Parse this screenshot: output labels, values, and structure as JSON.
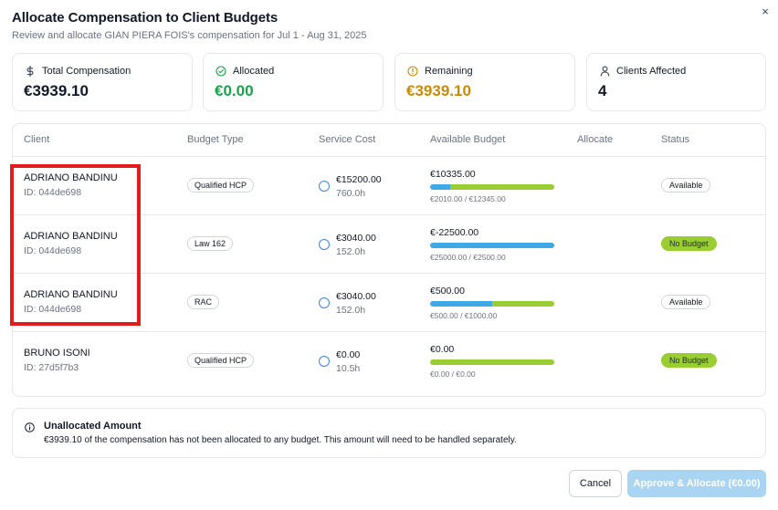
{
  "dialog": {
    "title": "Allocate Compensation to Client Budgets",
    "subtitle": "Review and allocate GIAN PIERA FOIS's compensation for Jul 1 - Aug 31, 2025",
    "close_glyph": "×"
  },
  "summary": {
    "total": {
      "label": "Total Compensation",
      "value": "€3939.10",
      "icon": "dollar-icon",
      "color": "#111827"
    },
    "allocated": {
      "label": "Allocated",
      "value": "€0.00",
      "icon": "check-circle-icon",
      "color": "#16a34a"
    },
    "remaining": {
      "label": "Remaining",
      "value": "€3939.10",
      "icon": "alert-circle-icon",
      "color": "#ca8a04"
    },
    "clients": {
      "label": "Clients Affected",
      "value": "4",
      "icon": "user-icon",
      "color": "#111827"
    }
  },
  "table": {
    "headers": {
      "client": "Client",
      "budget_type": "Budget Type",
      "service_cost": "Service Cost",
      "available_budget": "Available Budget",
      "allocate": "Allocate",
      "status": "Status"
    },
    "rows": [
      {
        "name": "ADRIANO BANDINU",
        "id": "ID: 044de698",
        "budget_type": "Qualified HCP",
        "cost": "€15200.00",
        "hours": "760.0h",
        "available": "€10335.00",
        "ratio": "€2010.00 / €12345.00",
        "used_fraction": 0.163,
        "status": "Available",
        "status_kind": "available"
      },
      {
        "name": "ADRIANO BANDINU",
        "id": "ID: 044de698",
        "budget_type": "Law 162",
        "cost": "€3040.00",
        "hours": "152.0h",
        "available": "€-22500.00",
        "ratio": "€25000.00 / €2500.00",
        "used_fraction": 1.0,
        "status": "No Budget",
        "status_kind": "nobudget"
      },
      {
        "name": "ADRIANO BANDINU",
        "id": "ID: 044de698",
        "budget_type": "RAC",
        "cost": "€3040.00",
        "hours": "152.0h",
        "available": "€500.00",
        "ratio": "€500.00 / €1000.00",
        "used_fraction": 0.5,
        "status": "Available",
        "status_kind": "available"
      },
      {
        "name": "BRUNO ISONI",
        "id": "ID: 27d5f7b3",
        "budget_type": "Qualified HCP",
        "cost": "€0.00",
        "hours": "10.5h",
        "available": "€0.00",
        "ratio": "€0.00 / €0.00",
        "used_fraction": 0,
        "status": "No Budget",
        "status_kind": "nobudget"
      }
    ]
  },
  "notice": {
    "title": "Unallocated Amount",
    "text": "€3939.10 of the compensation has not been allocated to any budget. This amount will need to be handled separately."
  },
  "footer": {
    "cancel_label": "Cancel",
    "approve_label": "Approve & Allocate (€0.00)"
  },
  "colors": {
    "bar_used": "#3ea9e6",
    "bar_remaining": "#9acd32",
    "highlight": "#e31b1b",
    "approve_disabled": "#a9d4f2"
  }
}
